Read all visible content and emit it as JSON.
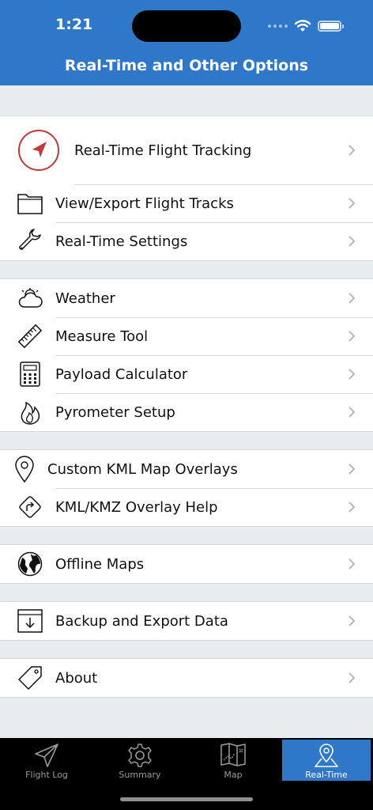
{
  "status": {
    "time": "1:21"
  },
  "header": {
    "title": "Real-Time and Other Options"
  },
  "groups": [
    {
      "items": [
        {
          "label": "Real-Time Flight Tracking",
          "icon": "location-arrow-icon"
        },
        {
          "label": "View/Export Flight Tracks",
          "icon": "folder-icon"
        },
        {
          "label": "Real-Time Settings",
          "icon": "wrench-icon"
        }
      ]
    },
    {
      "items": [
        {
          "label": "Weather",
          "icon": "cloud-sun-icon"
        },
        {
          "label": "Measure Tool",
          "icon": "ruler-icon"
        },
        {
          "label": "Payload Calculator",
          "icon": "calculator-icon"
        },
        {
          "label": "Pyrometer Setup",
          "icon": "flame-icon"
        }
      ]
    },
    {
      "items": [
        {
          "label": "Custom KML Map Overlays",
          "icon": "map-pin-icon"
        },
        {
          "label": "KML/KMZ Overlay Help",
          "icon": "direction-sign-icon"
        }
      ]
    },
    {
      "items": [
        {
          "label": "Offline Maps",
          "icon": "globe-icon"
        }
      ]
    },
    {
      "items": [
        {
          "label": "Backup and Export Data",
          "icon": "download-box-icon"
        }
      ]
    },
    {
      "items": [
        {
          "label": "About",
          "icon": "tag-icon"
        }
      ]
    }
  ],
  "tabs": [
    {
      "label": "Flight Log",
      "icon": "paper-plane-icon",
      "active": false
    },
    {
      "label": "Summary",
      "icon": "gear-icon",
      "active": false
    },
    {
      "label": "Map",
      "icon": "folded-map-icon",
      "active": false
    },
    {
      "label": "Real-Time",
      "icon": "map-pin-icon",
      "active": true
    }
  ],
  "colors": {
    "accent": "#2f77c8",
    "tracking_icon_red": "#c0393b"
  }
}
